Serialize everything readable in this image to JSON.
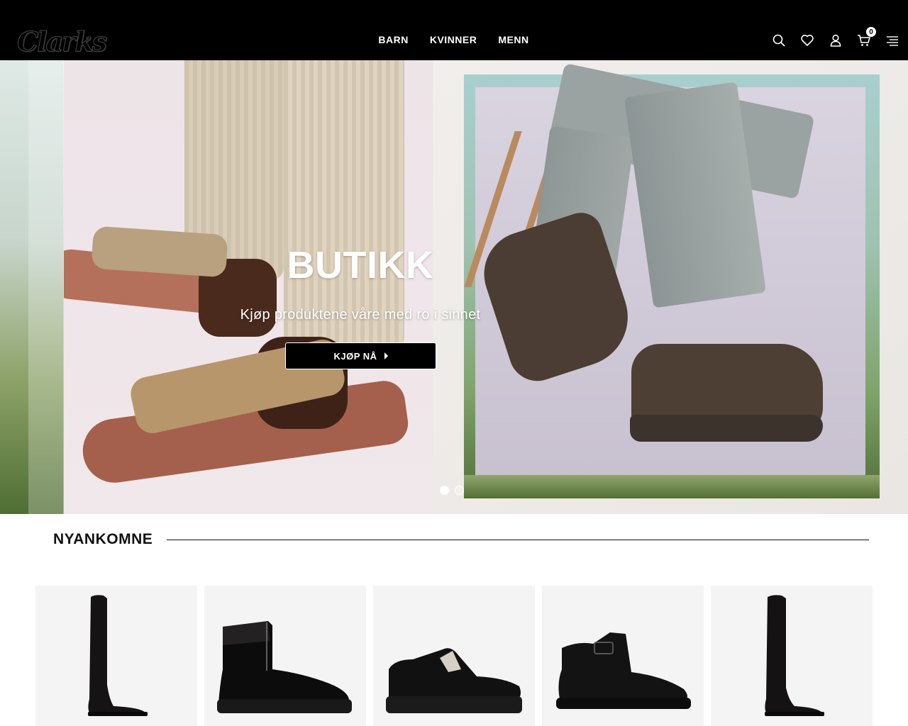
{
  "header": {
    "logo": "Clarks",
    "nav": [
      "BARN",
      "KVINNER",
      "MENN"
    ],
    "icons": [
      "search-icon",
      "heart-icon",
      "user-icon",
      "cart-icon",
      "menu-icon"
    ],
    "cart_count": "0"
  },
  "hero": {
    "title": "BUTIKK",
    "subtitle": "Kjøp produktene våre med ro i sinnet",
    "button": "KJØP NÅ",
    "slides": 2,
    "active_slide": 1
  },
  "section": {
    "title": "NYANKOMNE"
  },
  "products": [
    {
      "type": "tall-boot"
    },
    {
      "type": "patent-ankle-boot"
    },
    {
      "type": "wallabee"
    },
    {
      "type": "ankle-boot-buckle"
    },
    {
      "type": "tall-boot-leather"
    }
  ],
  "colors": {
    "header_bg": "#000000",
    "button_bg": "#000000",
    "text": "#111111"
  }
}
